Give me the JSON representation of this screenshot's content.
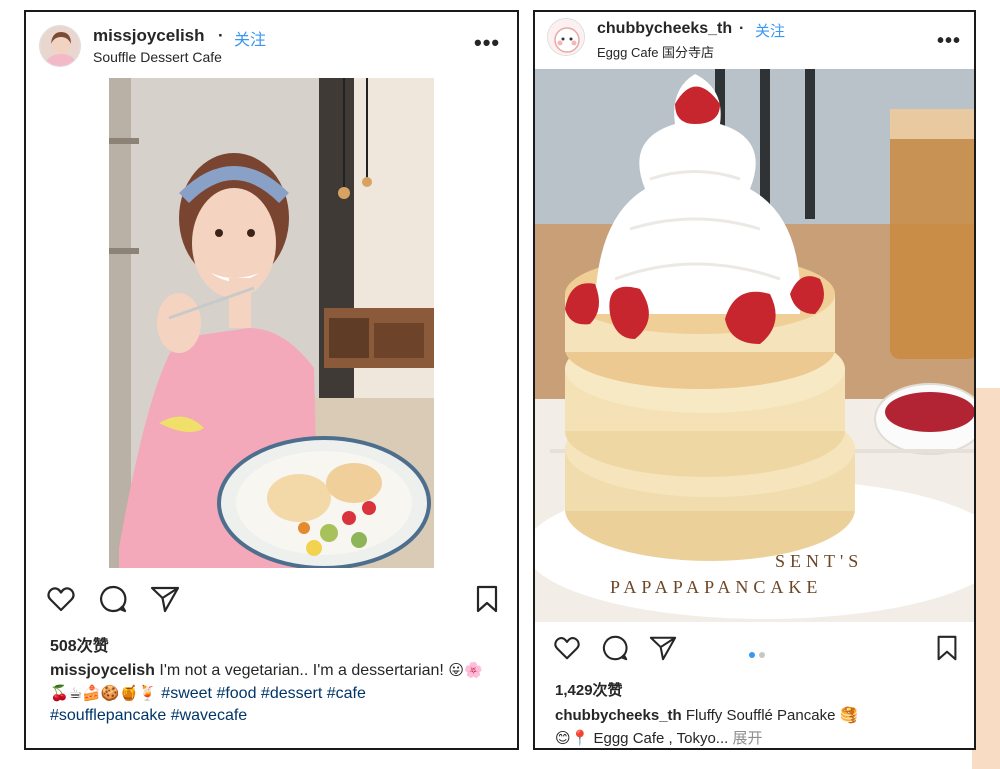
{
  "posts": [
    {
      "username": "missjoycelish",
      "separator": "·",
      "follow_label": "关注",
      "location": "Souffle Dessert Cafe",
      "more_icon": "more-horizontal-icon",
      "likes": "508次赞",
      "caption_user": "missjoycelish",
      "caption_text": " I'm not a vegetarian.. I'm a dessertarian! ",
      "caption_emoji": "😛🌸",
      "emoji_row": "🍒☕🍰🍪🍯🍹",
      "hashtags_line1": "#sweet #food #dessert #cafe",
      "hashtags_line2": "#soufflepancake #wavecafe",
      "icons": [
        "heart-icon",
        "comment-icon",
        "share-icon",
        "bookmark-icon"
      ]
    },
    {
      "username": "chubbycheeks_th",
      "separator": "·",
      "follow_label": "关注",
      "location": "Eggg Cafe 国分寺店",
      "more_icon": "more-horizontal-icon",
      "likes": "1,429次赞",
      "caption_user": "chubbycheeks_th",
      "caption_text": " Fluffy Soufflé Pancake ",
      "caption_emoji": "🥞",
      "caption_line2_emoji": "😊📍",
      "caption_line2_text": " Eggg Cafe , Tokyo... ",
      "more_label": "展开",
      "plate_text_1": "SENT'S",
      "plate_text_2": "PAPAPAPANCAKE",
      "carousel_count": 2,
      "carousel_active": 1,
      "icons": [
        "heart-icon",
        "comment-icon",
        "share-icon",
        "bookmark-icon"
      ]
    }
  ],
  "colors": {
    "follow_blue": "#3897f0",
    "hashtag_blue": "#003569",
    "border": "#1a1a1a",
    "peach_accent": "#f9dcc4"
  }
}
